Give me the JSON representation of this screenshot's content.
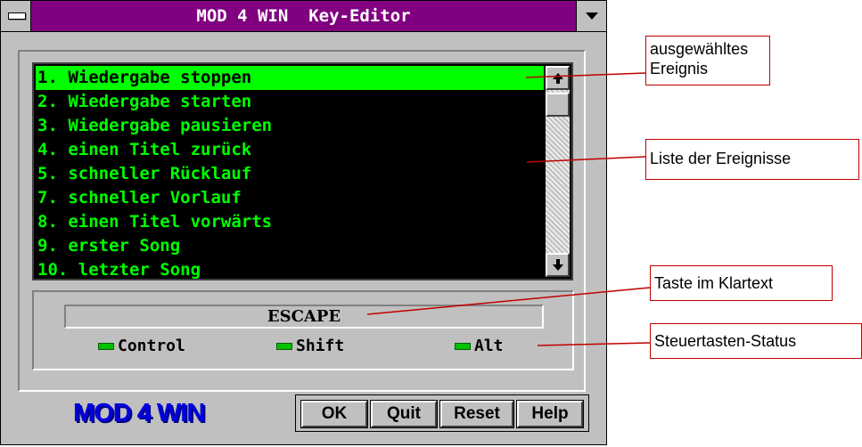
{
  "window": {
    "title": "MOD 4 WIN  Key-Editor"
  },
  "list": {
    "items": [
      "1. Wiedergabe stoppen",
      "2. Wiedergabe starten",
      "3. Wiedergabe pausieren",
      "4. einen Titel zurück",
      "5. schneller Rücklauf",
      "7. schneller Vorlauf",
      "8. einen Titel vorwärts",
      "9. erster Song",
      "10. letzter Song"
    ],
    "selected_index": 0
  },
  "key": {
    "text": "ESCAPE",
    "modifiers": [
      {
        "label": "Control",
        "active": false
      },
      {
        "label": "Shift",
        "active": false
      },
      {
        "label": "Alt",
        "active": false
      }
    ]
  },
  "logo": "MOD 4 WIN",
  "buttons": {
    "ok": "OK",
    "quit": "Quit",
    "reset": "Reset",
    "help": "Help"
  },
  "callouts": {
    "selected_line1": "ausgewähltes",
    "selected_line2": "Ereignis",
    "list": "Liste der Ereignisse",
    "key": "Taste im Klartext",
    "status": "Steuertasten-Status"
  },
  "colors": {
    "titlebar": "#800080",
    "list_text": "#00ff00",
    "list_bg": "#000000",
    "selection_bg": "#00ff00",
    "logo": "#0000e0",
    "callout_border": "#c00000",
    "led": "#00c000"
  }
}
